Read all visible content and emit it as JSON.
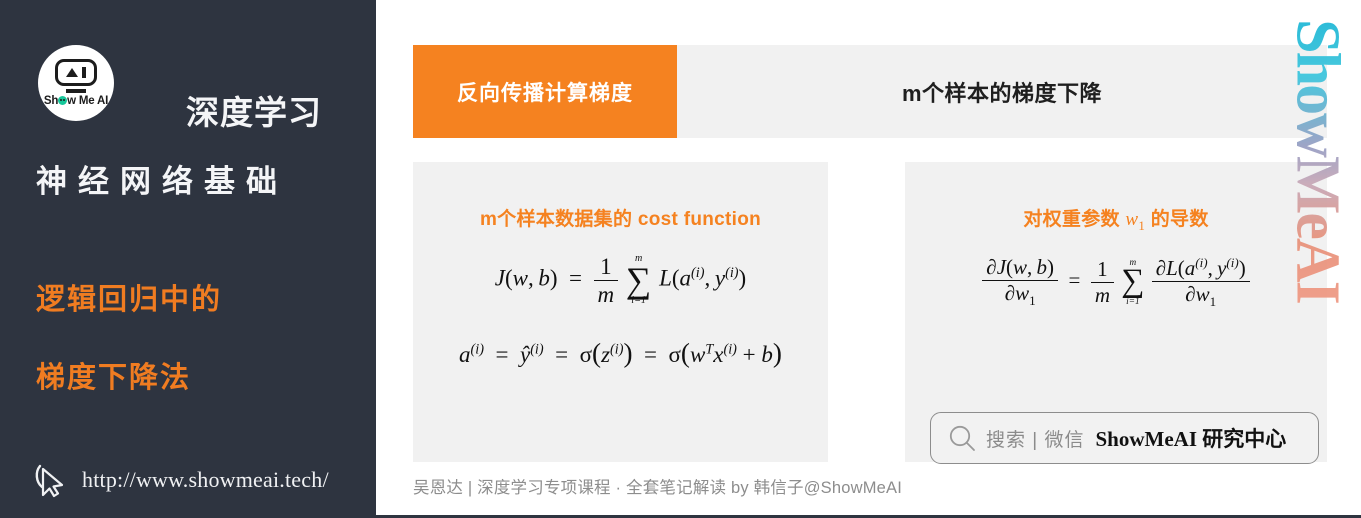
{
  "sidebar": {
    "logo": {
      "icon": "showmeai-robot-logo",
      "wordmark_before": "Sh",
      "wordmark_dot": "o",
      "wordmark_after": "w Me AI"
    },
    "title_line1": "深度学习",
    "title_line2": "神经网络基础",
    "subtitle_line1": "逻辑回归中的",
    "subtitle_line2": "梯度下降法",
    "cursor_icon": "mouse-pointer-icon",
    "url": "http://www.showmeai.tech/",
    "background_color": "#2e3440",
    "accent_color": "#f07c21"
  },
  "header": {
    "tag_label": "反向传播计算梯度",
    "title": "m个样本的梯度下降",
    "tag_color": "#f58220",
    "band_color": "#f1f1f1"
  },
  "panels": {
    "left": {
      "heading_cn": "m个样本数据集的 ",
      "heading_en": "cost function",
      "equation_1": "J(w, b) = (1/m) Σ_{i=1}^{m} L(a^(i), y^(i))",
      "equation_2": "a^(i) = ŷ^(i) = σ(z^(i)) = σ(w^T x^(i) + b)"
    },
    "right": {
      "heading_prefix": "对权重参数 ",
      "heading_var": "w",
      "heading_var_sub": "1",
      "heading_suffix": " 的导数",
      "equation_1": "∂J(w, b)/∂w₁ = (1/m) Σ_{i=1}^{m} ∂L(a^(i), y^(i))/∂w₁"
    }
  },
  "search_pill": {
    "icon": "search-magnifier-icon",
    "label": "搜索 | 微信",
    "brand": "ShowMeAI 研究中心"
  },
  "footer": {
    "note": "吴恩达 | 深度学习专项课程 · 全套笔记解读  by 韩信子@ShowMeAI"
  },
  "watermark": {
    "text": "ShowMeAI"
  },
  "math_symbols": {
    "J": "J",
    "L": "L",
    "a": "a",
    "y": "y",
    "z": "z",
    "w": "w",
    "b": "b",
    "m": "m",
    "sigma": "σ",
    "partial": "∂",
    "sum": "∑",
    "hat_y": "ŷ",
    "sup_i": "(i)",
    "sup_T": "T",
    "lim_bottom": "i=1",
    "lim_top": "m",
    "equals": "=",
    "plus": "+",
    "comma": ",",
    "lparen": "(",
    "rparen": ")"
  }
}
